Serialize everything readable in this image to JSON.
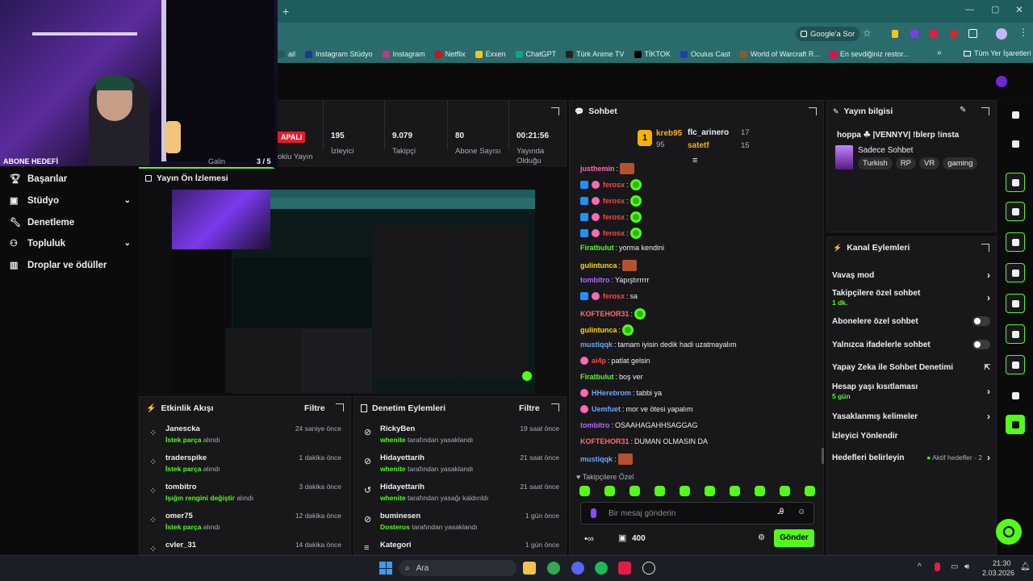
{
  "browser": {
    "address_action": "Google'a Sor",
    "bookmarks": [
      "ail",
      "Instagram Stüdyo",
      "Instagram",
      "Netflix",
      "Exxen",
      "ChatGPT",
      "Türk Anime TV",
      "TİKTOK",
      "Oculus Cast",
      "World of Warcraft R...",
      "En sevdiğiniz restor..."
    ],
    "all_bookmarks": "Tüm Yer İşaretleri",
    "bookmark_colors": [
      "#1f5c5c",
      "#1e3a8a",
      "#c13584",
      "#e50914",
      "#f5c518",
      "#10a37f",
      "#222",
      "#000",
      "#1e40af",
      "#8b5a2b",
      "#fa0050"
    ]
  },
  "overlay": {
    "goal_label": "ABONE HEDEFİ",
    "goal_count": "3 / 5",
    "goal_progress": 0.6
  },
  "sidebar": {
    "items": [
      {
        "label": "Başarılar",
        "icon": "trophy-icon"
      },
      {
        "label": "Stüdyo",
        "icon": "studio-icon",
        "chevron": true
      },
      {
        "label": "Denetleme",
        "icon": "wrench-icon"
      },
      {
        "label": "Topluluk",
        "icon": "community-icon",
        "chevron": true
      },
      {
        "label": "Droplar ve ödüller",
        "icon": "gift-icon"
      }
    ]
  },
  "stats": {
    "status_badge": "APALI",
    "partial_label": "Galin",
    "status_sub": "oklu Yayın",
    "items": [
      {
        "value": "195",
        "label": "İzleyici"
      },
      {
        "value": "9.079",
        "label": "Takipçi"
      },
      {
        "value": "80",
        "label": "Abone Sayısı"
      },
      {
        "value": "00:21:56",
        "label": "Yayında Olduğu"
      }
    ]
  },
  "preview": {
    "title": "Yayın Ön İzlemesi"
  },
  "activity": {
    "title": "Etkinlik Akışı",
    "filter": "Filtre",
    "rows": [
      {
        "name": "Janescka",
        "action_g": "İstek parça",
        "action": " alındı",
        "time": "24 saniye önce"
      },
      {
        "name": "traderspike",
        "action_g": "İstek parça",
        "action": " alındı",
        "time": "1 dakika önce"
      },
      {
        "name": "tombitro",
        "action_g": "Işığın rengini değiştir",
        "action": " alındı",
        "time": "3 dakika önce"
      },
      {
        "name": "omer75",
        "action_g": "İstek parça",
        "action": " alındı",
        "time": "12 dakika önce"
      },
      {
        "name": "cvler_31",
        "action_g": "",
        "action": "",
        "time": "14 dakika önce"
      }
    ]
  },
  "moderation": {
    "title": "Denetim Eylemleri",
    "filter": "Filtre",
    "rows": [
      {
        "name": "RickyBen",
        "by": "whenite",
        "action": " tarafından yasaklandı",
        "time": "19 saat önce"
      },
      {
        "name": "Hidayettarih",
        "by": "whenite",
        "action": " tarafından yasaklandı",
        "time": "21 saat önce"
      },
      {
        "name": "Hidayettarih",
        "by": "whenite",
        "action": " tarafından yasağı kaldırıldı",
        "time": "21 saat önce"
      },
      {
        "name": "buminesen",
        "by": "Dosterus",
        "action": " tarafından yasaklandı",
        "time": "1 gün önce"
      },
      {
        "name": "Kategori",
        "by": "",
        "action": "",
        "time": "1 gün önce"
      }
    ]
  },
  "chat": {
    "title": "Sohbet",
    "leaders": [
      {
        "rank": "1",
        "name": "kreb95",
        "score": "95"
      },
      {
        "name": "flc_arinero",
        "score": "17"
      },
      {
        "name": "satetf",
        "score": "15"
      }
    ],
    "messages": [
      {
        "user": "justhemin",
        "color": "#ff69b4",
        "text": "",
        "emote": "box",
        "badges": 0
      },
      {
        "user": "ferosx",
        "color": "#ff4545",
        "text": "",
        "emote": "clover",
        "badges": 2
      },
      {
        "user": "ferosx",
        "color": "#ff4545",
        "text": "",
        "emote": "clover",
        "badges": 2
      },
      {
        "user": "ferosx",
        "color": "#ff4545",
        "text": "",
        "emote": "clover",
        "badges": 2
      },
      {
        "user": "ferosx",
        "color": "#ff4545",
        "text": "",
        "emote": "clover",
        "badges": 2
      },
      {
        "user": "Firatbulut",
        "color": "#53fc18",
        "text": "yorma kendini",
        "emote": "",
        "badges": 0
      },
      {
        "user": "gulintunca",
        "color": "#ffd700",
        "text": "",
        "emote": "box",
        "badges": 0
      },
      {
        "user": "tombitro",
        "color": "#b266ff",
        "text": "Yapıştırrrrr",
        "emote": "",
        "badges": 0
      },
      {
        "user": "ferosx",
        "color": "#ff4545",
        "text": "sa",
        "emote": "",
        "badges": 2
      },
      {
        "user": "KOFTEHOR31",
        "color": "#ff6b6b",
        "text": "",
        "emote": "clover",
        "badges": 0
      },
      {
        "user": "gulintunca",
        "color": "#ffd700",
        "text": "",
        "emote": "clover",
        "badges": 0
      },
      {
        "user": "mustiqqk",
        "color": "#66aaff",
        "text": "tamam iyisin dedik hadi uzatmayalım",
        "emote": "",
        "badges": 0
      },
      {
        "user": "ai4p",
        "color": "#ff4545",
        "text": "patlat gelsin",
        "emote": "",
        "badges": 1
      },
      {
        "user": "Firatbulut",
        "color": "#53fc18",
        "text": "boş ver",
        "emote": "",
        "badges": 0
      },
      {
        "user": "HHerebrom",
        "color": "#66aaff",
        "text": "tabbi ya",
        "emote": "",
        "badges": 1
      },
      {
        "user": "Uemfuet",
        "color": "#66aaff",
        "text": "mor ve ötesi yapalım",
        "emote": "",
        "badges": 1
      },
      {
        "user": "tombitro",
        "color": "#b266ff",
        "text": "OSAAHAGAHHSAGGAG",
        "emote": "",
        "badges": 0
      },
      {
        "user": "KOFTEHOR31",
        "color": "#ff6b6b",
        "text": "DUMAN OLMASIN DA",
        "emote": "",
        "badges": 0
      },
      {
        "user": "mustiqqk",
        "color": "#66aaff",
        "text": "",
        "emote": "box",
        "badges": 0
      }
    ],
    "mode_label": "Takipçilere Özel",
    "input_placeholder": "Bir mesaj gönderin",
    "points": "400",
    "send": "Gönder"
  },
  "stream_info": {
    "title": "Yayın bilgisi",
    "stream_title": "hoppa ☘ |VENNYV| !blerp !insta",
    "category": "Sadece Sohbet",
    "tags": [
      "Turkish",
      "RP",
      "VR",
      "gaming"
    ]
  },
  "actions": {
    "title": "Kanal Eylemleri",
    "items": [
      {
        "label": "Vavaş mod",
        "sub": "",
        "control": "chevron"
      },
      {
        "label": "Takipçilere özel sohbet",
        "sub": "1 dk.",
        "control": "chevron"
      },
      {
        "label": "Abonelere özel sohbet",
        "sub": "",
        "control": "toggle"
      },
      {
        "label": "Yalnızca ifadelerle sohbet",
        "sub": "",
        "control": "toggle"
      },
      {
        "label": "Yapay Zeka ile Sohbet Denetimi",
        "sub": "",
        "control": "external"
      },
      {
        "label": "Hesap yaşı kısıtlaması",
        "sub": "5 gün",
        "control": "chevron"
      },
      {
        "label": "Yasaklanmış kelimeler",
        "sub": "",
        "control": "chevron"
      },
      {
        "label": "İzleyici Yönlendir",
        "sub": "",
        "control": ""
      },
      {
        "label": "Hedefleri belirleyin",
        "sub": "",
        "control": "chevron",
        "badge": "Aktif hedefler - 2"
      }
    ]
  },
  "taskbar": {
    "search": "Ara",
    "time": "21:30",
    "date": "2.03.2026"
  }
}
